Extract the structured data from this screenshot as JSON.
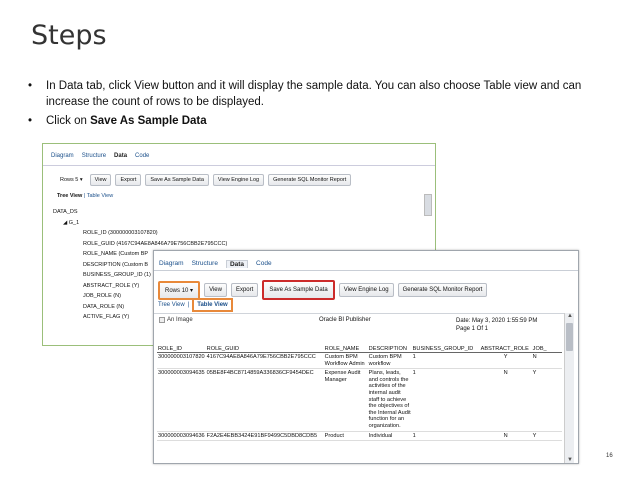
{
  "slide": {
    "title": "Steps",
    "page_number": "16"
  },
  "bullets": {
    "b1": "In Data tab, click View button and it will display the sample data. You can also choose Table view and can increase the count of rows to be displayed.",
    "b2_prefix": "Click on ",
    "b2_bold": "Save As Sample Data",
    "bullet_glyph": "•"
  },
  "shot1": {
    "tabs": [
      "Diagram",
      "Structure",
      "Data",
      "Code"
    ],
    "rows_label": "Rows",
    "rows_value": "5",
    "buttons": [
      "View",
      "Export",
      "Save As Sample Data",
      "View Engine Log",
      "Generate SQL Monitor Report"
    ],
    "tree_view": "Tree View",
    "separator": "|",
    "table_view": "Table View",
    "tree": {
      "root": "DATA_DS",
      "group": "G_1",
      "items": [
        "ROLE_ID (300000003107820)",
        "ROLE_GUID (4167C94AE8A846A79E756CBB2E795CCC)",
        "ROLE_NAME (Custom BP",
        "DESCRIPTION (Custom B",
        "BUSINESS_GROUP_ID (1)",
        "ABSTRACT_ROLE (Y)",
        "JOB_ROLE (N)",
        "DATA_ROLE (N)",
        "ACTIVE_FLAG (Y)"
      ]
    }
  },
  "shot2": {
    "tabs": [
      "Diagram",
      "Structure",
      "Data",
      "Code"
    ],
    "rows_label": "Rows",
    "rows_value": "10",
    "buttons": [
      "View",
      "Export",
      "Save As Sample Data",
      "View Engine Log",
      "Generate SQL Monitor Report"
    ],
    "tree_view": "Tree View",
    "separator": "|",
    "table_view": "Table View",
    "image_alt": "An Image",
    "publisher": "Oracle BI Publisher",
    "date": "Date: May 3, 2020 1:55:59 PM",
    "page": "Page 1 Of 1",
    "columns": [
      "ROLE_ID",
      "ROLE_GUID",
      "ROLE_NAME",
      "DESCRIPTION",
      "BUSINESS_GROUP_ID",
      "ABSTRACT_ROLE",
      "JOB_"
    ],
    "rows": [
      [
        "300000003107820",
        "4167C94AE8A846A79E756CBB2E795CCC",
        "Custom BPM Workflow Admin",
        "Custom BPM workflow",
        "1",
        "Y",
        "N"
      ],
      [
        "300000003094635",
        "05BE8F4BC8714859A336836CF9454DEC",
        "Expense Audit Manager",
        "Plans, leads, and controls the activities of the internal audit staff to achieve the objectives of the Internal Audit function for an organization.",
        "1",
        "N",
        "Y"
      ],
      [
        "300000003094636",
        "F2A2E4EBB3424E91BF9499C5DBD8CDB5",
        "Product",
        "Individual",
        "1",
        "N",
        "Y"
      ]
    ]
  },
  "colors": {
    "highlight_orange": "#e8893a",
    "highlight_red": "#cc2b2b",
    "frame_green": "#9bbf7a",
    "link_blue": "#1a4f8a"
  }
}
